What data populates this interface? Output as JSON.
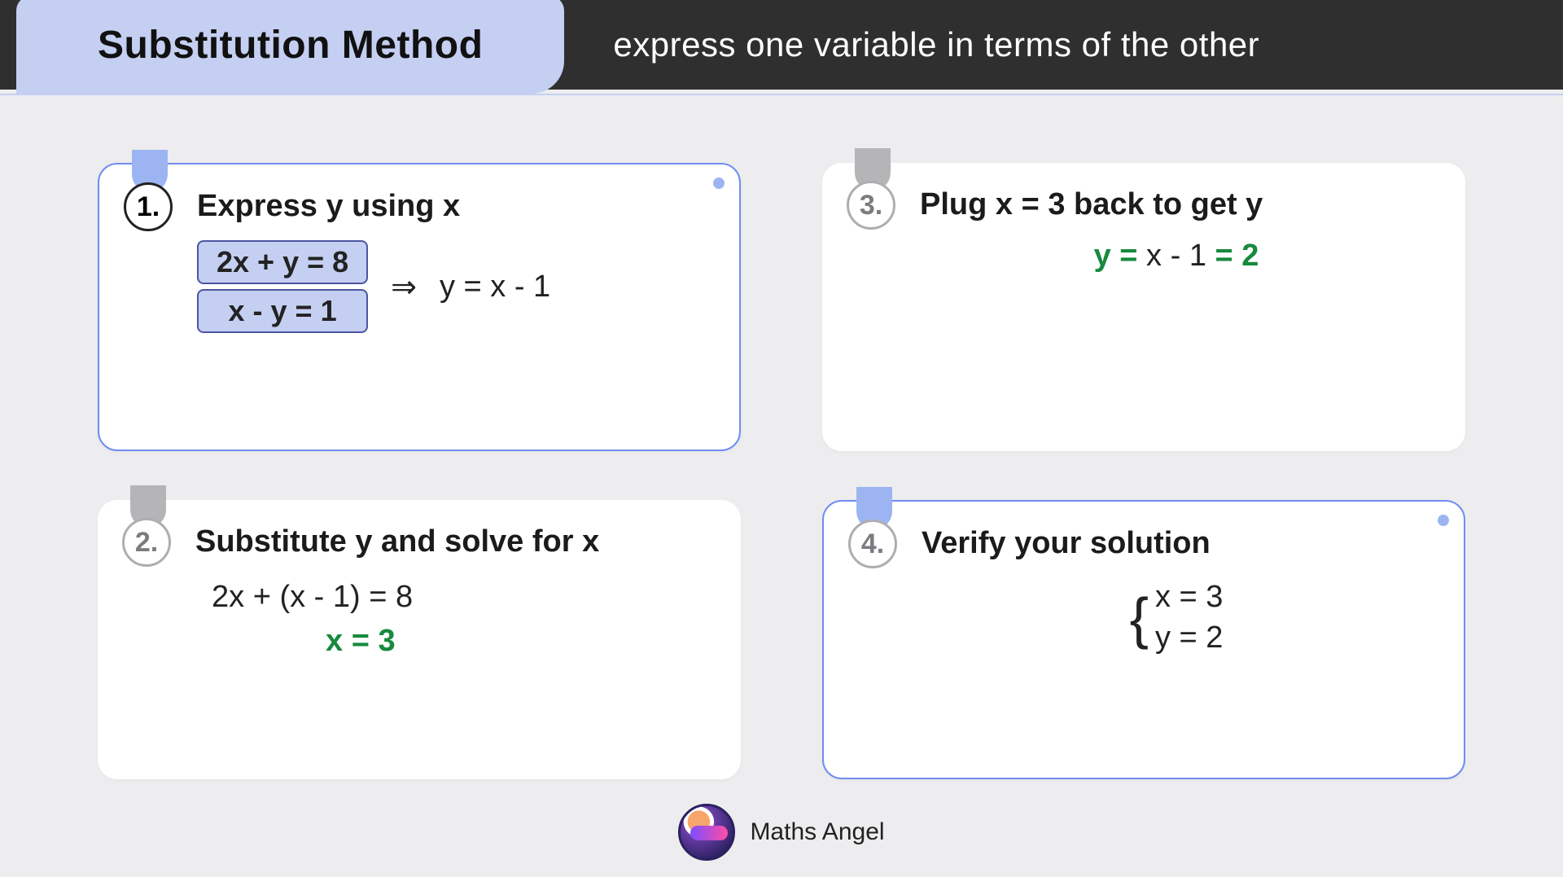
{
  "header": {
    "title": "Substitution Method",
    "subtitle": "express one variable in terms of the other"
  },
  "steps": {
    "s1": {
      "num": "1.",
      "title": "Express y using x",
      "eq1": "2x + y = 8",
      "eq2": "x - y = 1",
      "arrow": "⇒",
      "result": "y = x - 1"
    },
    "s2": {
      "num": "2.",
      "title": "Substitute y and solve for x",
      "line1": "2x + (x - 1) = 8",
      "line2": "x = 3"
    },
    "s3": {
      "num": "3.",
      "title": "Plug x = 3 back to get y",
      "pre": "y =",
      "mid": " x - 1 ",
      "post": "= 2"
    },
    "s4": {
      "num": "4.",
      "title": "Verify your solution",
      "sol1": "x = 3",
      "sol2": "y = 2"
    }
  },
  "footer": {
    "brand": "Maths Angel"
  }
}
